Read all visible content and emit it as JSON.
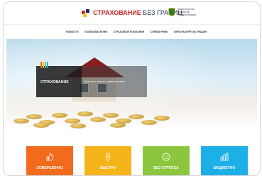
{
  "header": {
    "logo_text_red": "СТРАХОВАНИЕ",
    "logo_text_blue": "БЕЗ ГРАНИЦ",
    "partner_text": "Министерство финансов Приднестровья"
  },
  "nav": {
    "items": [
      "Новости",
      "Пользователям",
      "Страховые компании",
      "Справочник",
      "Обратная регистрация"
    ]
  },
  "hero": {
    "title": "СТРАХОВАНИЕ",
    "subtitle": "Безопасно, просто, надёжно и легко."
  },
  "colors": {
    "tile_1": "#f26a1b",
    "tile_2": "#f5b41a",
    "tile_3": "#8cc63f",
    "tile_4": "#1cb0e6"
  },
  "tiles": [
    {
      "label": "СОВЕРШЕННО",
      "icon": "thumbs-up-icon"
    },
    {
      "label": "БЫСТРО",
      "icon": "stopwatch-icon"
    },
    {
      "label": "БЕЗ СТРЕССА",
      "icon": "smile-icon"
    },
    {
      "label": "БЮДЖЕТНО",
      "icon": "bar-chart-icon"
    }
  ]
}
